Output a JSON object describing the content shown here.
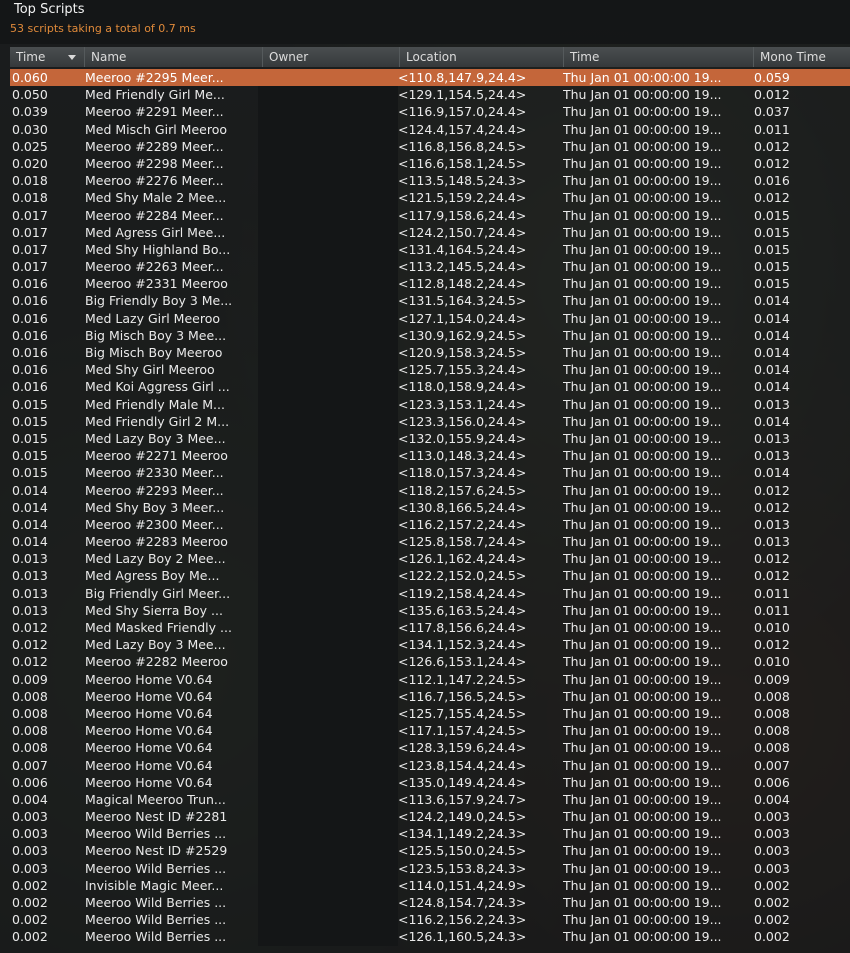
{
  "window": {
    "title": "Top Scripts",
    "summary": "53 scripts taking a total of 0.7 ms"
  },
  "columns": {
    "time": "Time",
    "name": "Name",
    "owner": "Owner",
    "location": "Location",
    "date": "Time",
    "mono": "Mono Time"
  },
  "colors": {
    "selected_row": "#c4663a",
    "summary_text": "#e08a3a"
  },
  "rows": [
    {
      "time": "0.060",
      "name": "Meeroo #2295 Meer...",
      "owner": "",
      "location": "<110.8,147.9,24.4>",
      "date": "Thu Jan 01 00:00:00 19...",
      "mono": "0.059"
    },
    {
      "time": "0.050",
      "name": "Med Friendly Girl Me...",
      "owner": "",
      "location": "<129.1,154.5,24.4>",
      "date": "Thu Jan 01 00:00:00 19...",
      "mono": "0.012"
    },
    {
      "time": "0.039",
      "name": "Meeroo #2291 Meer...",
      "owner": "",
      "location": "<116.9,157.0,24.4>",
      "date": "Thu Jan 01 00:00:00 19...",
      "mono": "0.037"
    },
    {
      "time": "0.030",
      "name": "Med Misch Girl Meeroo",
      "owner": "",
      "location": "<124.4,157.4,24.4>",
      "date": "Thu Jan 01 00:00:00 19...",
      "mono": "0.011"
    },
    {
      "time": "0.025",
      "name": "Meeroo #2289 Meer...",
      "owner": "",
      "location": "<116.8,156.8,24.5>",
      "date": "Thu Jan 01 00:00:00 19...",
      "mono": "0.012"
    },
    {
      "time": "0.020",
      "name": "Meeroo #2298 Meer...",
      "owner": "",
      "location": "<116.6,158.1,24.5>",
      "date": "Thu Jan 01 00:00:00 19...",
      "mono": "0.012"
    },
    {
      "time": "0.018",
      "name": "Meeroo #2276 Meer...",
      "owner": "",
      "location": "<113.5,148.5,24.3>",
      "date": "Thu Jan 01 00:00:00 19...",
      "mono": "0.016"
    },
    {
      "time": "0.018",
      "name": "Med Shy Male 2 Mee...",
      "owner": "",
      "location": "<121.5,159.2,24.4>",
      "date": "Thu Jan 01 00:00:00 19...",
      "mono": "0.012"
    },
    {
      "time": "0.017",
      "name": "Meeroo #2284 Meer...",
      "owner": "",
      "location": "<117.9,158.6,24.4>",
      "date": "Thu Jan 01 00:00:00 19...",
      "mono": "0.015"
    },
    {
      "time": "0.017",
      "name": "Med Agress Girl Mee...",
      "owner": "",
      "location": "<124.2,150.7,24.4>",
      "date": "Thu Jan 01 00:00:00 19...",
      "mono": "0.015"
    },
    {
      "time": "0.017",
      "name": "Med Shy Highland Bo...",
      "owner": "",
      "location": "<131.4,164.5,24.4>",
      "date": "Thu Jan 01 00:00:00 19...",
      "mono": "0.015"
    },
    {
      "time": "0.017",
      "name": "Meeroo #2263 Meer...",
      "owner": "",
      "location": "<113.2,145.5,24.4>",
      "date": "Thu Jan 01 00:00:00 19...",
      "mono": "0.015"
    },
    {
      "time": "0.016",
      "name": "Meeroo #2331 Meeroo",
      "owner": "",
      "location": "<112.8,148.2,24.4>",
      "date": "Thu Jan 01 00:00:00 19...",
      "mono": "0.015"
    },
    {
      "time": "0.016",
      "name": "Big Friendly Boy 3 Me...",
      "owner": "",
      "location": "<131.5,164.3,24.5>",
      "date": "Thu Jan 01 00:00:00 19...",
      "mono": "0.014"
    },
    {
      "time": "0.016",
      "name": "Med Lazy Girl Meeroo",
      "owner": "",
      "location": "<127.1,154.0,24.4>",
      "date": "Thu Jan 01 00:00:00 19...",
      "mono": "0.014"
    },
    {
      "time": "0.016",
      "name": "Big Misch Boy 3 Mee...",
      "owner": "",
      "location": "<130.9,162.9,24.5>",
      "date": "Thu Jan 01 00:00:00 19...",
      "mono": "0.014"
    },
    {
      "time": "0.016",
      "name": "Big Misch Boy Meeroo",
      "owner": "",
      "location": "<120.9,158.3,24.5>",
      "date": "Thu Jan 01 00:00:00 19...",
      "mono": "0.014"
    },
    {
      "time": "0.016",
      "name": "Med Shy Girl Meeroo",
      "owner": "",
      "location": "<125.7,155.3,24.4>",
      "date": "Thu Jan 01 00:00:00 19...",
      "mono": "0.014"
    },
    {
      "time": "0.016",
      "name": "Med Koi Aggress Girl ...",
      "owner": "",
      "location": "<118.0,158.9,24.4>",
      "date": "Thu Jan 01 00:00:00 19...",
      "mono": "0.014"
    },
    {
      "time": "0.015",
      "name": "Med Friendly Male M...",
      "owner": "",
      "location": "<123.3,153.1,24.4>",
      "date": "Thu Jan 01 00:00:00 19...",
      "mono": "0.013"
    },
    {
      "time": "0.015",
      "name": "Med Friendly Girl 2 M...",
      "owner": "",
      "location": "<123.3,156.0,24.4>",
      "date": "Thu Jan 01 00:00:00 19...",
      "mono": "0.014"
    },
    {
      "time": "0.015",
      "name": "Med Lazy Boy 3 Mee...",
      "owner": "",
      "location": "<132.0,155.9,24.4>",
      "date": "Thu Jan 01 00:00:00 19...",
      "mono": "0.013"
    },
    {
      "time": "0.015",
      "name": "Meeroo #2271 Meeroo",
      "owner": "",
      "location": "<113.0,148.3,24.4>",
      "date": "Thu Jan 01 00:00:00 19...",
      "mono": "0.013"
    },
    {
      "time": "0.015",
      "name": "Meeroo #2330 Meer...",
      "owner": "",
      "location": "<118.0,157.3,24.4>",
      "date": "Thu Jan 01 00:00:00 19...",
      "mono": "0.014"
    },
    {
      "time": "0.014",
      "name": "Meeroo #2293 Meer...",
      "owner": "",
      "location": "<118.2,157.6,24.5>",
      "date": "Thu Jan 01 00:00:00 19...",
      "mono": "0.012"
    },
    {
      "time": "0.014",
      "name": "Med Shy Boy 3 Meer...",
      "owner": "",
      "location": "<130.8,166.5,24.4>",
      "date": "Thu Jan 01 00:00:00 19...",
      "mono": "0.012"
    },
    {
      "time": "0.014",
      "name": "Meeroo #2300 Meer...",
      "owner": "",
      "location": "<116.2,157.2,24.4>",
      "date": "Thu Jan 01 00:00:00 19...",
      "mono": "0.013"
    },
    {
      "time": "0.014",
      "name": "Meeroo #2283 Meeroo",
      "owner": "",
      "location": "<125.8,158.7,24.4>",
      "date": "Thu Jan 01 00:00:00 19...",
      "mono": "0.013"
    },
    {
      "time": "0.013",
      "name": "Med Lazy Boy 2 Mee...",
      "owner": "",
      "location": "<126.1,162.4,24.4>",
      "date": "Thu Jan 01 00:00:00 19...",
      "mono": "0.012"
    },
    {
      "time": "0.013",
      "name": "Med Agress Boy Me...",
      "owner": "",
      "location": "<122.2,152.0,24.5>",
      "date": "Thu Jan 01 00:00:00 19...",
      "mono": "0.012"
    },
    {
      "time": "0.013",
      "name": "Big Friendly Girl Meer...",
      "owner": "",
      "location": "<119.2,158.4,24.4>",
      "date": "Thu Jan 01 00:00:00 19...",
      "mono": "0.011"
    },
    {
      "time": "0.013",
      "name": "Med Shy Sierra Boy ...",
      "owner": "",
      "location": "<135.6,163.5,24.4>",
      "date": "Thu Jan 01 00:00:00 19...",
      "mono": "0.011"
    },
    {
      "time": "0.012",
      "name": "Med Masked Friendly ...",
      "owner": "",
      "location": "<117.8,156.6,24.4>",
      "date": "Thu Jan 01 00:00:00 19...",
      "mono": "0.010"
    },
    {
      "time": "0.012",
      "name": "Med Lazy Boy 3 Mee...",
      "owner": "",
      "location": "<134.1,152.3,24.4>",
      "date": "Thu Jan 01 00:00:00 19...",
      "mono": "0.012"
    },
    {
      "time": "0.012",
      "name": "Meeroo #2282 Meeroo",
      "owner": "",
      "location": "<126.6,153.1,24.4>",
      "date": "Thu Jan 01 00:00:00 19...",
      "mono": "0.010"
    },
    {
      "time": "0.009",
      "name": "Meeroo Home V0.64",
      "owner": "",
      "location": "<112.1,147.2,24.5>",
      "date": "Thu Jan 01 00:00:00 19...",
      "mono": "0.009"
    },
    {
      "time": "0.008",
      "name": "Meeroo Home V0.64",
      "owner": "",
      "location": "<116.7,156.5,24.5>",
      "date": "Thu Jan 01 00:00:00 19...",
      "mono": "0.008"
    },
    {
      "time": "0.008",
      "name": "Meeroo Home V0.64",
      "owner": "",
      "location": "<125.7,155.4,24.5>",
      "date": "Thu Jan 01 00:00:00 19...",
      "mono": "0.008"
    },
    {
      "time": "0.008",
      "name": "Meeroo Home V0.64",
      "owner": "",
      "location": "<117.1,157.4,24.5>",
      "date": "Thu Jan 01 00:00:00 19...",
      "mono": "0.008"
    },
    {
      "time": "0.008",
      "name": "Meeroo Home V0.64",
      "owner": "",
      "location": "<128.3,159.6,24.4>",
      "date": "Thu Jan 01 00:00:00 19...",
      "mono": "0.008"
    },
    {
      "time": "0.007",
      "name": "Meeroo Home V0.64",
      "owner": "",
      "location": "<123.8,154.4,24.4>",
      "date": "Thu Jan 01 00:00:00 19...",
      "mono": "0.007"
    },
    {
      "time": "0.006",
      "name": "Meeroo Home V0.64",
      "owner": "",
      "location": "<135.0,149.4,24.4>",
      "date": "Thu Jan 01 00:00:00 19...",
      "mono": "0.006"
    },
    {
      "time": "0.004",
      "name": "Magical Meeroo Trun...",
      "owner": "",
      "location": "<113.6,157.9,24.7>",
      "date": "Thu Jan 01 00:00:00 19...",
      "mono": "0.004"
    },
    {
      "time": "0.003",
      "name": "Meeroo Nest ID #2281",
      "owner": "",
      "location": "<124.2,149.0,24.5>",
      "date": "Thu Jan 01 00:00:00 19...",
      "mono": "0.003"
    },
    {
      "time": "0.003",
      "name": "Meeroo Wild Berries ...",
      "owner": "",
      "location": "<134.1,149.2,24.3>",
      "date": "Thu Jan 01 00:00:00 19...",
      "mono": "0.003"
    },
    {
      "time": "0.003",
      "name": "Meeroo Nest ID #2529",
      "owner": "",
      "location": "<125.5,150.0,24.5>",
      "date": "Thu Jan 01 00:00:00 19...",
      "mono": "0.003"
    },
    {
      "time": "0.003",
      "name": "Meeroo Wild Berries ...",
      "owner": "",
      "location": "<123.5,153.8,24.3>",
      "date": "Thu Jan 01 00:00:00 19...",
      "mono": "0.003"
    },
    {
      "time": "0.002",
      "name": "Invisible Magic Meer...",
      "owner": "",
      "location": "<114.0,151.4,24.9>",
      "date": "Thu Jan 01 00:00:00 19...",
      "mono": "0.002"
    },
    {
      "time": "0.002",
      "name": "Meeroo Wild Berries ...",
      "owner": "",
      "location": "<124.8,154.7,24.3>",
      "date": "Thu Jan 01 00:00:00 19...",
      "mono": "0.002"
    },
    {
      "time": "0.002",
      "name": "Meeroo Wild Berries ...",
      "owner": "",
      "location": "<116.2,156.2,24.3>",
      "date": "Thu Jan 01 00:00:00 19...",
      "mono": "0.002"
    },
    {
      "time": "0.002",
      "name": "Meeroo Wild Berries ...",
      "owner": "",
      "location": "<126.1,160.5,24.3>",
      "date": "Thu Jan 01 00:00:00 19...",
      "mono": "0.002"
    }
  ]
}
